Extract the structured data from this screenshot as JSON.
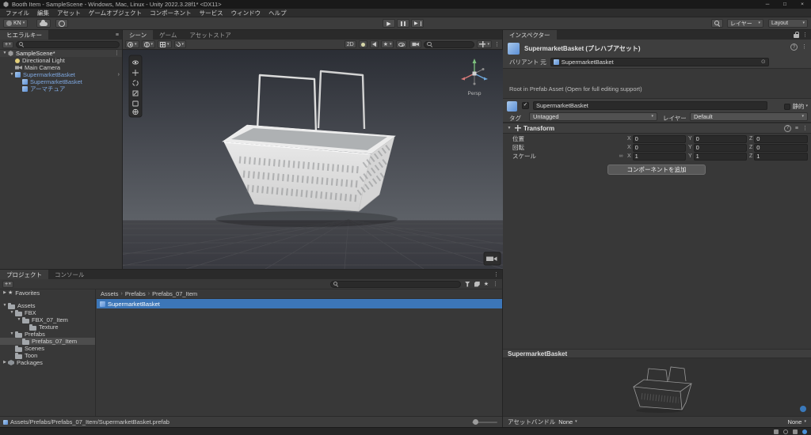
{
  "colors": {
    "selection_blue": "#3c76b8",
    "panel_bg": "#383838",
    "prefab_text": "#7fa8e0",
    "selected_row_gray": "#4d4d4d"
  },
  "icons": {
    "minimize": "─",
    "maximize": "□",
    "close": "×",
    "dropdown": "▾",
    "foldout_open": "▼",
    "foldout_closed": "▶",
    "hamburger": "≡",
    "kebab": "⋮",
    "star": "★",
    "check": "✓",
    "breadcrumb_sep": "›",
    "picker": "⊙",
    "link": "∞",
    "help": "?",
    "play": "▶",
    "plus": "+",
    "presets": "≡",
    "prefab_open": "›"
  },
  "title_bar": {
    "title": "Booth Item - SampleScene - Windows, Mac, Linux - Unity 2022.3.28f1* <DX11>"
  },
  "menu_bar": {
    "items": [
      "ファイル",
      "編集",
      "アセット",
      "ゲームオブジェクト",
      "コンポーネント",
      "サービス",
      "ウィンドウ",
      "ヘルプ"
    ]
  },
  "toolbar": {
    "account_label": "KN",
    "layers_label": "レイヤー",
    "layout_label": "Layout"
  },
  "hierarchy": {
    "tab": "ヒエラルキー",
    "rows": [
      {
        "label": "SampleScene*",
        "icon": "scene",
        "depth": 0,
        "expanded": true,
        "bold": true,
        "scene_row": true,
        "kebab": true
      },
      {
        "label": "Directional Light",
        "icon": "light",
        "depth": 1
      },
      {
        "label": "Main Camera",
        "icon": "camera",
        "depth": 1
      },
      {
        "label": "SupermarketBasket",
        "icon": "prefab",
        "depth": 1,
        "expanded": true,
        "prefab": true,
        "open_arrow": true
      },
      {
        "label": "SupermarketBasket",
        "icon": "prefab",
        "depth": 2,
        "prefab": true
      },
      {
        "label": "アーマチュア",
        "icon": "prefab",
        "depth": 2,
        "prefab": true
      }
    ]
  },
  "scene": {
    "tabs": [
      {
        "label": "シーン",
        "active": true
      },
      {
        "label": "ゲーム",
        "active": false
      },
      {
        "label": "アセットストア",
        "active": false
      }
    ],
    "toolbar": {
      "mode_2d": "2D"
    },
    "persp_label": "Persp"
  },
  "inspector": {
    "tab": "インスペクター",
    "header": {
      "title": "SupermarketBasket (プレハブアセット)"
    },
    "variant": {
      "label": "バリアント 元",
      "value": "SupermarketBasket"
    },
    "root_note": "Root in Prefab Asset (Open for full editing support)",
    "gameobject": {
      "name": "SupermarketBasket",
      "static_label": "静的",
      "tag_label": "タグ",
      "tag_value": "Untagged",
      "layer_label": "レイヤー",
      "layer_value": "Default"
    },
    "transform": {
      "title": "Transform",
      "axis_labels": [
        "X",
        "Y",
        "Z"
      ],
      "rows": [
        {
          "label": "位置",
          "values": [
            "0",
            "0",
            "0"
          ]
        },
        {
          "label": "回転",
          "values": [
            "0",
            "0",
            "0"
          ]
        },
        {
          "label": "スケール",
          "values": [
            "1",
            "1",
            "1"
          ],
          "link": true
        }
      ]
    },
    "add_component_label": "コンポーネントを追加",
    "preview": {
      "title": "SupermarketBasket"
    },
    "asset_bundle": {
      "label": "アセットバンドル",
      "bundle": "None",
      "variant": "None"
    }
  },
  "project": {
    "tabs": [
      {
        "label": "プロジェクト",
        "active": true
      },
      {
        "label": "コンソール",
        "active": false
      }
    ],
    "tree": [
      {
        "label": "Favorites",
        "icon": "star",
        "depth": 0,
        "collapsed": true,
        "gap_after": true
      },
      {
        "label": "Assets",
        "icon": "folder",
        "depth": 0,
        "expanded": true
      },
      {
        "label": "FBX",
        "icon": "folder",
        "depth": 1,
        "expanded": true
      },
      {
        "label": "FBX_07_Item",
        "icon": "folder",
        "depth": 2,
        "expanded": true
      },
      {
        "label": "Texture",
        "icon": "folder",
        "depth": 3
      },
      {
        "label": "Prefabs",
        "icon": "folder",
        "depth": 1,
        "expanded": true
      },
      {
        "label": "Prefabs_07_Item",
        "icon": "folder",
        "depth": 2,
        "selected": true
      },
      {
        "label": "Scenes",
        "icon": "folder",
        "depth": 1
      },
      {
        "label": "Toon",
        "icon": "folder",
        "depth": 1
      },
      {
        "label": "Packages",
        "icon": "package",
        "depth": 0,
        "collapsed": true
      }
    ],
    "breadcrumb": [
      "Assets",
      "Prefabs",
      "Prefabs_07_Item"
    ],
    "selected_asset": "SupermarketBasket",
    "footer_path": "Assets/Prefabs/Prefabs_07_Item/SupermarketBasket.prefab"
  }
}
